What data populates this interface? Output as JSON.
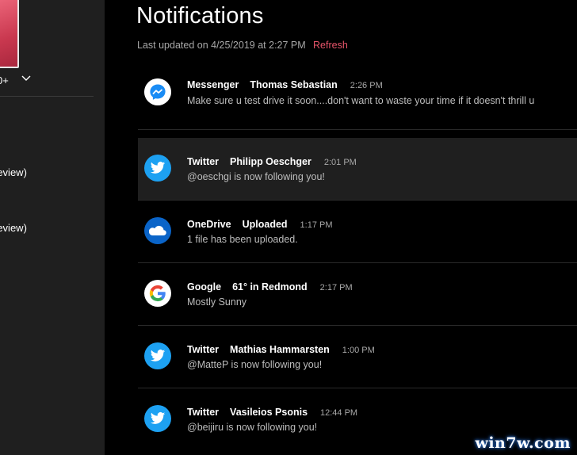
{
  "sidebar": {
    "age_label": "0+",
    "items": [
      {
        "label": "review)"
      },
      {
        "label": "review)"
      }
    ]
  },
  "header": {
    "title": "Notifications",
    "last_updated": "Last updated on 4/25/2019 at 2:27 PM",
    "refresh_label": "Refresh"
  },
  "notifications": [
    {
      "app": "Messenger",
      "title": "Thomas Sebastian",
      "time": "2:26 PM",
      "body": "Make sure u test drive it soon....don't want to waste your time if it doesn't thrill u",
      "icon": "messenger-icon"
    },
    {
      "app": "Twitter",
      "title": "Philipp Oeschger",
      "time": "2:01 PM",
      "body": "@oeschgi is now following you!",
      "icon": "twitter-icon"
    },
    {
      "app": "OneDrive",
      "title": "Uploaded",
      "time": "1:17 PM",
      "body": "1 file has been uploaded.",
      "icon": "onedrive-icon"
    },
    {
      "app": "Google",
      "title": "61° in Redmond",
      "time": "2:17 PM",
      "body": "Mostly Sunny",
      "icon": "google-icon"
    },
    {
      "app": "Twitter",
      "title": "Mathias Hammarsten",
      "time": "1:00 PM",
      "body": "@MatteP is now following you!",
      "icon": "twitter-icon"
    },
    {
      "app": "Twitter",
      "title": "Vasileios Psonis",
      "time": "12:44 PM",
      "body": "@beijiru is now following you!",
      "icon": "twitter-icon"
    }
  ],
  "watermark": "win7w.com",
  "colors": {
    "accent": "#e8556a",
    "messenger": "#1a8cf5",
    "twitter": "#1da1f2",
    "onedrive": "#0a64c8",
    "selected_row": "#1f1f1f"
  }
}
